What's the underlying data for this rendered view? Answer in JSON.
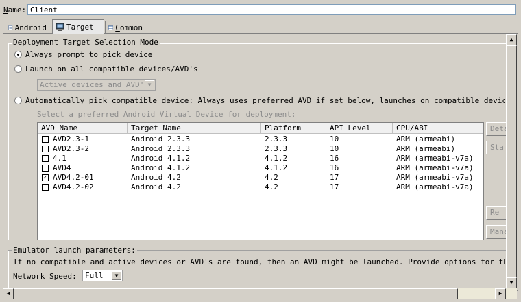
{
  "name_label": "Name:",
  "name_value": "Client",
  "tabs": [
    {
      "label": "Android",
      "icon": "document-icon"
    },
    {
      "label": "Target",
      "icon": "device-icon"
    },
    {
      "label": "Common",
      "icon": "table-icon"
    }
  ],
  "deployment": {
    "group_title": "Deployment Target Selection Mode",
    "opt_prompt": "Always prompt to pick device",
    "opt_launch_all": "Launch on all compatible devices/AVD's",
    "launch_all_combo": "Active devices and AVD's",
    "opt_auto": "Automatically pick compatible device: Always uses preferred AVD if set below, launches on compatible device/AVD other",
    "select_hint": "Select a preferred Android Virtual Device for deployment:",
    "selected_option": "prompt"
  },
  "avd_table": {
    "headers": [
      "AVD Name",
      "Target Name",
      "Platform",
      "API Level",
      "CPU/ABI"
    ],
    "rows": [
      {
        "checked": false,
        "name": "AVD2.3-1",
        "target": "Android 2.3.3",
        "platform": "2.3.3",
        "api": "10",
        "abi": "ARM (armeabi)"
      },
      {
        "checked": false,
        "name": "AVD2.3-2",
        "target": "Android 2.3.3",
        "platform": "2.3.3",
        "api": "10",
        "abi": "ARM (armeabi)"
      },
      {
        "checked": false,
        "name": "4.1",
        "target": "Android 4.1.2",
        "platform": "4.1.2",
        "api": "16",
        "abi": "ARM (armeabi-v7a)"
      },
      {
        "checked": false,
        "name": "AVD4",
        "target": "Android 4.1.2",
        "platform": "4.1.2",
        "api": "16",
        "abi": "ARM (armeabi-v7a)"
      },
      {
        "checked": true,
        "name": "AVD4.2-01",
        "target": "Android 4.2",
        "platform": "4.2",
        "api": "17",
        "abi": "ARM (armeabi-v7a)"
      },
      {
        "checked": false,
        "name": "AVD4.2-02",
        "target": "Android 4.2",
        "platform": "4.2",
        "api": "17",
        "abi": "ARM (armeabi-v7a)"
      }
    ]
  },
  "side_buttons": {
    "details": "Deta",
    "start": "Sta",
    "refresh": "Re",
    "manager": "Mana"
  },
  "emulator": {
    "group_title": "Emulator launch parameters:",
    "description": "If no compatible and active devices or AVD's are found, then an AVD might be launched. Provide options for the AVD launc",
    "network_speed_label": "Network Speed:",
    "network_speed_value": "Full"
  }
}
